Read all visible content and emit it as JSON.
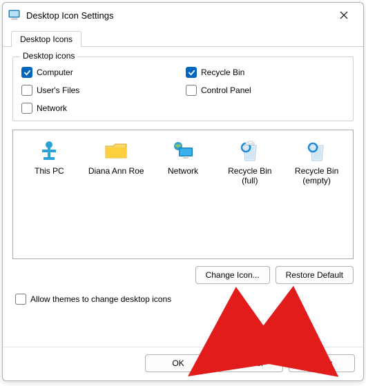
{
  "window": {
    "title": "Desktop Icon Settings"
  },
  "tab": {
    "label": "Desktop Icons"
  },
  "group": {
    "legend": "Desktop icons",
    "computer": "Computer",
    "users_files": "User's Files",
    "network": "Network",
    "recycle_bin": "Recycle Bin",
    "control_panel": "Control Panel"
  },
  "icons": {
    "this_pc": "This PC",
    "user": "Diana Ann Roe",
    "network": "Network",
    "recycle_full": "Recycle Bin (full)",
    "recycle_empty": "Recycle Bin (empty)"
  },
  "buttons": {
    "change_icon": "Change Icon...",
    "restore_default": "Restore Default",
    "ok": "OK",
    "cancel": "Cancel",
    "apply": "Apply"
  },
  "allow_themes": "Allow themes to change desktop icons"
}
